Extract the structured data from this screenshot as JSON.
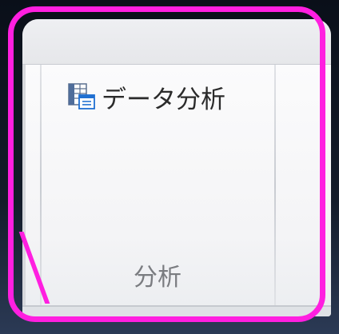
{
  "ribbon": {
    "group": {
      "button_label": "データ分析",
      "button_icon": "data-analysis-icon",
      "group_label": "分析"
    }
  },
  "colors": {
    "highlight": "#ff1fe0",
    "ribbon_bg": "#f7f7f8",
    "label_text": "#2b2b2b",
    "group_label_text": "#7a7c80"
  }
}
